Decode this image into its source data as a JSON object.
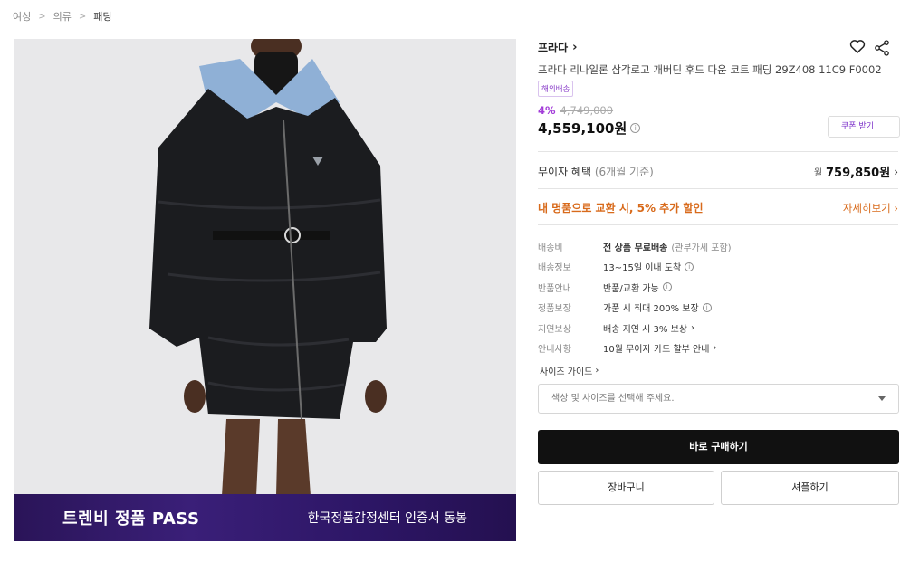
{
  "breadcrumb": {
    "items": [
      "여성",
      "의류",
      "패딩"
    ]
  },
  "product": {
    "brand": "프라다",
    "title": "프라다 리나일론 삼각로고 개버딘 후드 다운 코트 패딩 29Z408 11C9 F0002",
    "badge": "해외배송",
    "discount_rate": "4%",
    "original_price": "4,749,000",
    "price": "4,559,100원",
    "coupon_label": "쿠폰 받기"
  },
  "installment": {
    "label": "무이자 혜택",
    "note": "(6개월 기준)",
    "prefix": "월",
    "amount": "759,850원"
  },
  "exchange": {
    "label": "내 명품으로 교환 시, 5% 추가 할인",
    "link": "자세히보기"
  },
  "details": [
    {
      "label": "배송비",
      "value": "전 상품 무료배송",
      "note": "(관부가세 포함)"
    },
    {
      "label": "배송정보",
      "value": "13~15일 이내 도착"
    },
    {
      "label": "반품안내",
      "value": "반품/교환 가능"
    },
    {
      "label": "정품보장",
      "value": "가품 시 최대 200% 보장"
    },
    {
      "label": "지연보상",
      "value": "배송 지연 시 3% 보상"
    },
    {
      "label": "안내사항",
      "value": "10월 무이자 카드 할부 안내"
    }
  ],
  "size_guide": "사이즈 가이드",
  "option_select": {
    "placeholder": "색상 및 사이즈를 선택해 주세요."
  },
  "buttons": {
    "buy": "바로 구매하기",
    "cart": "장바구니",
    "shuffle": "셔플하기"
  },
  "banner": {
    "left": "트렌비 정품 PASS",
    "right": "한국정품감정센터 인증서 동봉"
  },
  "colors": {
    "accent_purple": "#a23bd8",
    "orange": "#d86a1b",
    "banner_bg": "#2d1666",
    "buy_bg": "#111111"
  }
}
